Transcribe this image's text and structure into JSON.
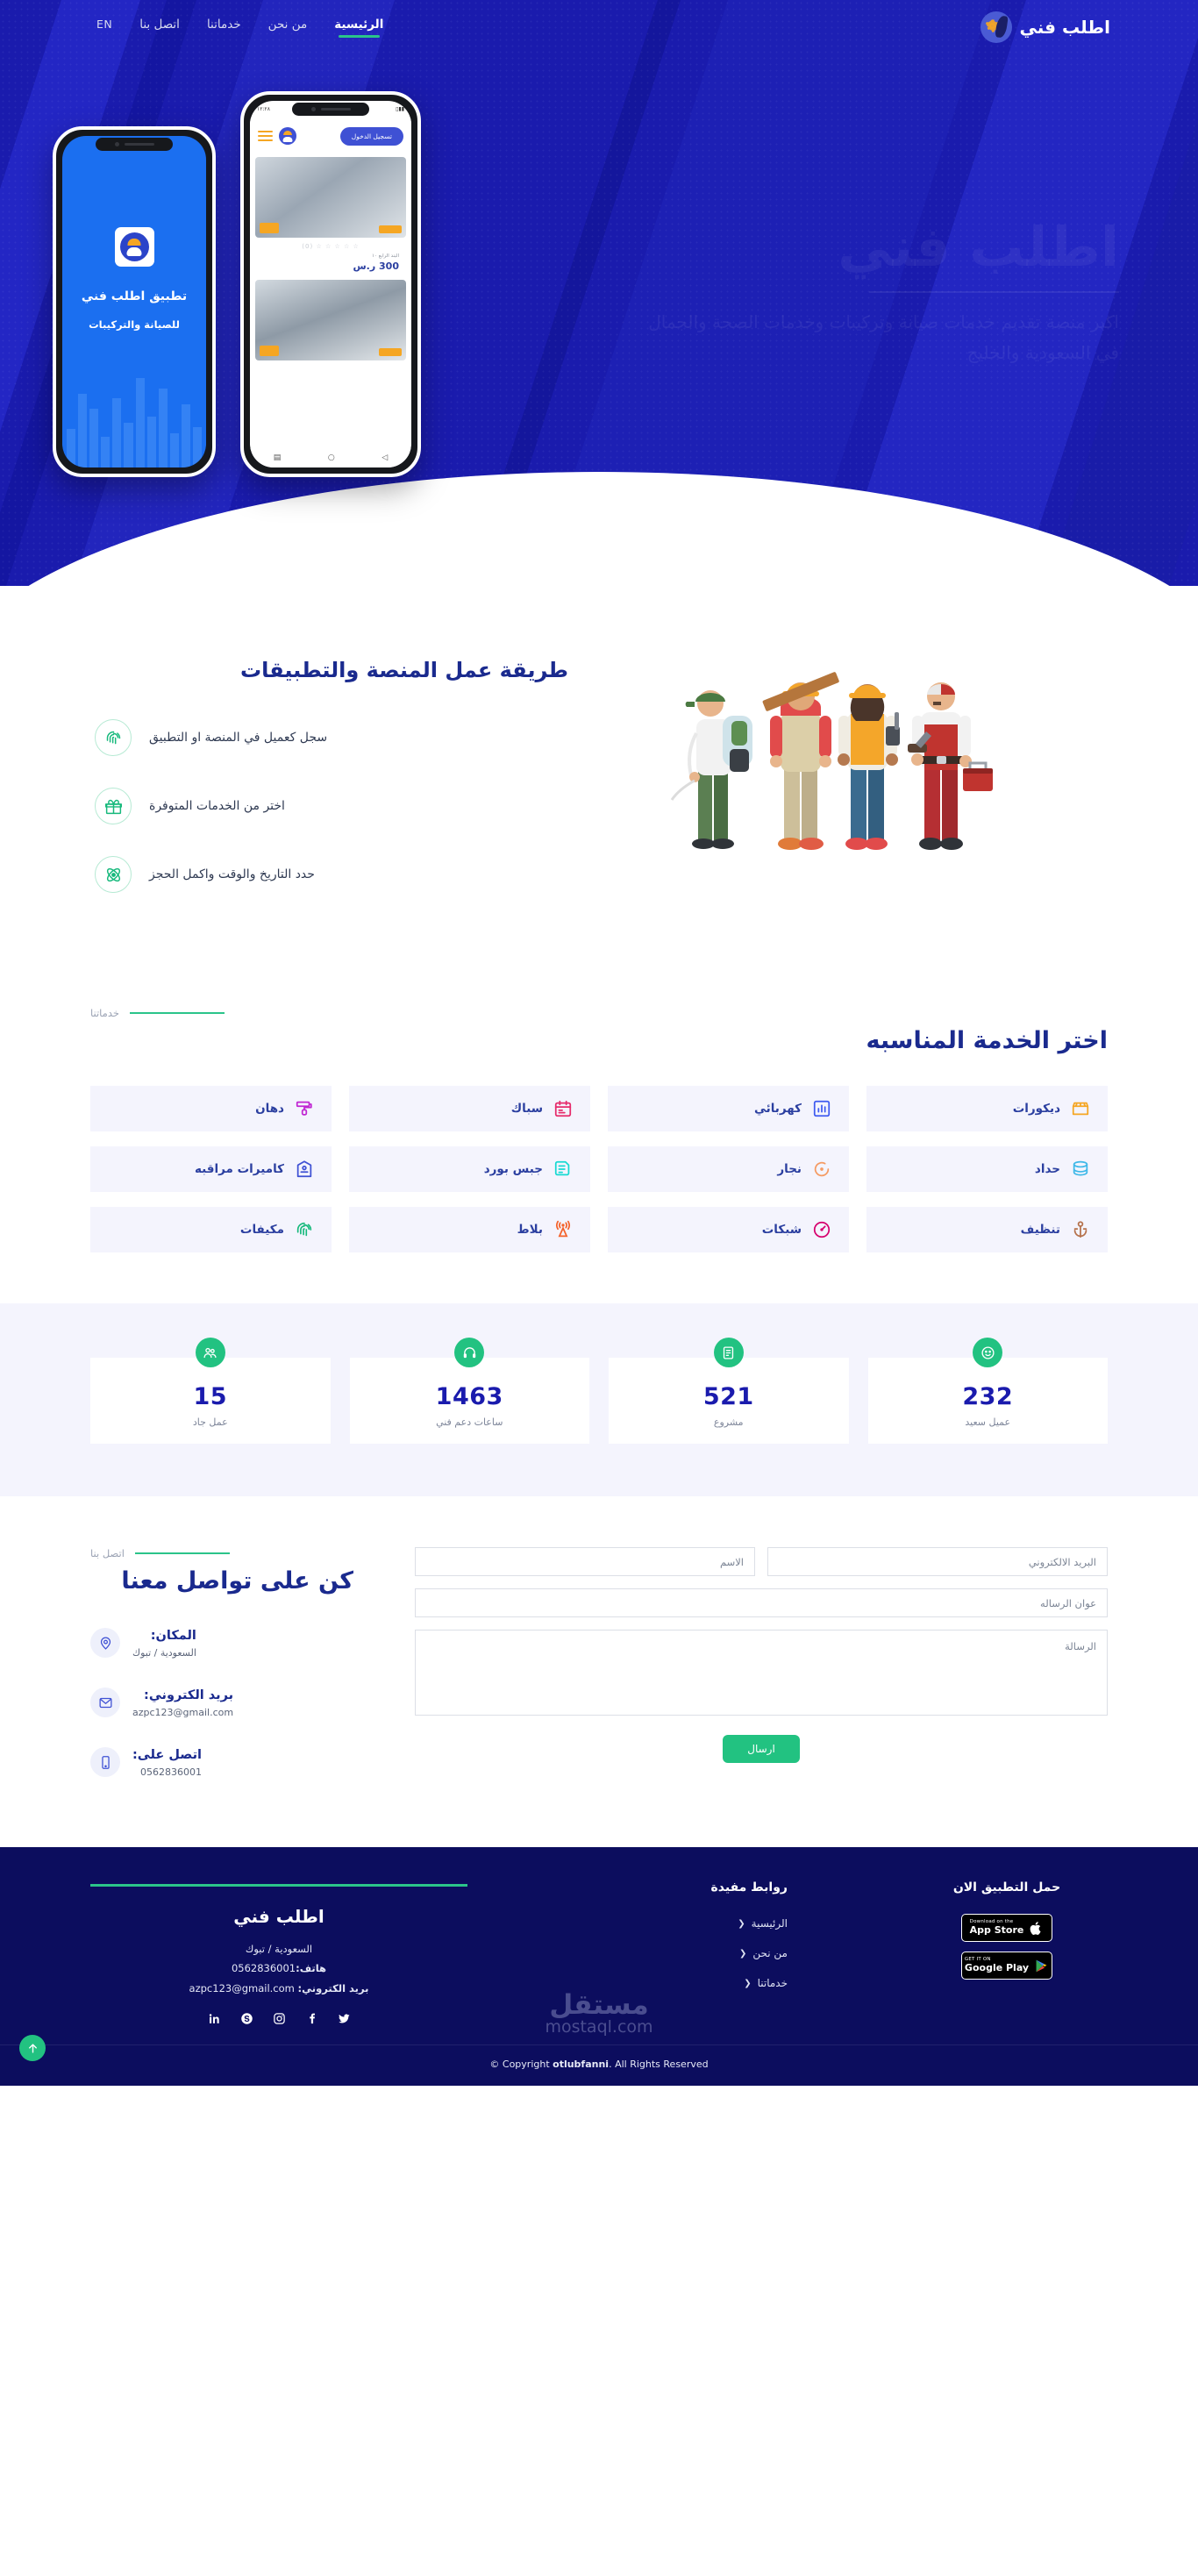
{
  "brand": {
    "name": "اطلب فني",
    "logo_icon": "gear-worker-logo-icon"
  },
  "nav": {
    "items": [
      {
        "label": "الرئيسية",
        "active": true
      },
      {
        "label": "من نحن",
        "active": false
      },
      {
        "label": "خدماتنا",
        "active": false
      },
      {
        "label": "اتصل بنا",
        "active": false
      },
      {
        "label": "EN",
        "active": false
      }
    ]
  },
  "hero": {
    "title": "اطلب فني",
    "subtitle_line1": "اكبر منصة تقديم خدمات صيانة وتركيبات وخدمات الصحة والجمال",
    "subtitle_line2": "في السعودية والخليج",
    "phone_back": {
      "title": "تطبيق اطلب فني",
      "subtitle": "للصيانة والتركيبات"
    },
    "phone_front": {
      "login_button": "تسجيل الدخول",
      "rating": "☆ ☆ ☆ ☆ ☆ (0)",
      "item_desc": "البند الرابع ١٠",
      "price": "300 ر.س",
      "status_time": "١٢:٢٨"
    }
  },
  "how": {
    "title": "طريقة عمل المنصة والتطبيقات",
    "steps": [
      {
        "text": "سجل كعميل في المنصة او التطبيق",
        "icon": "fingerprint-icon"
      },
      {
        "text": "اختر من الخدمات المتوفرة",
        "icon": "gift-icon"
      },
      {
        "text": "حدد التاريخ والوقت واكمل الحجز",
        "icon": "atom-icon"
      }
    ]
  },
  "services": {
    "eyebrow": "خدماتنا",
    "title": "اختر الخدمة المناسبه",
    "items": [
      {
        "label": "ديكورات",
        "icon": "storefront-icon",
        "color": "#f5a623"
      },
      {
        "label": "كهربائي",
        "icon": "chart-bars-icon",
        "color": "#3f5bf0"
      },
      {
        "label": "سباك",
        "icon": "calendar-icon",
        "color": "#e62b6b"
      },
      {
        "label": "دهان",
        "icon": "paint-roller-icon",
        "color": "#c026d3"
      },
      {
        "label": "حداد",
        "icon": "database-icon",
        "color": "#3eb8e8"
      },
      {
        "label": "نجار",
        "icon": "target-icon",
        "color": "#f59b63"
      },
      {
        "label": "جبس بورد",
        "icon": "document-icon",
        "color": "#16d9d2"
      },
      {
        "label": "كاميرات مراقبه",
        "icon": "tag-badge-icon",
        "color": "#3f51d4"
      },
      {
        "label": "تنظيف",
        "icon": "anchor-icon",
        "color": "#b5714b"
      },
      {
        "label": "شبكات",
        "icon": "speedometer-icon",
        "color": "#d6006e"
      },
      {
        "label": "بلاط",
        "icon": "broadcast-icon",
        "color": "#f4622a"
      },
      {
        "label": "مكيفات",
        "icon": "fingerprint-icon",
        "color": "#17b97c"
      }
    ]
  },
  "stats": {
    "items": [
      {
        "value": "232",
        "label": "عميل سعيد",
        "icon": "smiley-icon"
      },
      {
        "value": "521",
        "label": "مشروع",
        "icon": "clipboard-icon"
      },
      {
        "value": "1463",
        "label": "ساعات دعم فني",
        "icon": "headset-icon"
      },
      {
        "value": "15",
        "label": "عمل جاد",
        "icon": "users-icon"
      }
    ]
  },
  "contact": {
    "eyebrow": "اتصل بنا",
    "title": "كن على تواصل معنا",
    "info": [
      {
        "label": "المكان:",
        "value": "السعودية / تبوك",
        "icon": "map-pin-icon"
      },
      {
        "label": "بريد الكتروني:",
        "value": "azpc123@gmail.com",
        "icon": "envelope-icon"
      },
      {
        "label": "اتصل على:",
        "value": "0562836001",
        "icon": "mobile-phone-icon"
      }
    ],
    "form": {
      "name_placeholder": "الاسم",
      "email_placeholder": "البريد الالكتروني",
      "subject_placeholder": "عوان الرساله",
      "message_placeholder": "الرسالة",
      "submit_label": "ارسال"
    }
  },
  "footer": {
    "brand_name": "اطلب فني",
    "location": "السعودية / تبوك",
    "phone_label": "هاتف:",
    "phone_value": "0562836001",
    "email_label": "بريد الكتروني:",
    "email_value": "azpc123@gmail.com",
    "socials": [
      {
        "name": "twitter-icon"
      },
      {
        "name": "facebook-icon"
      },
      {
        "name": "instagram-icon"
      },
      {
        "name": "skype-icon"
      },
      {
        "name": "linkedin-icon"
      }
    ],
    "links_head": "روابط مفيدة",
    "links": [
      {
        "label": "الرئيسية"
      },
      {
        "label": "من نحن"
      },
      {
        "label": "خدماتنا"
      }
    ],
    "apps_head": "حمل التطبيق الان",
    "app_store": {
      "small": "Download on the",
      "big": "App Store"
    },
    "google_play": {
      "small": "GET IT ON",
      "big": "Google Play"
    },
    "watermark_ar": "مستقل",
    "watermark_en": "mostaql.com",
    "copyright_pre": "Copyright ",
    "copyright_brand": "otlubfanni",
    "copyright_post": ". All Rights Reserved ©"
  }
}
